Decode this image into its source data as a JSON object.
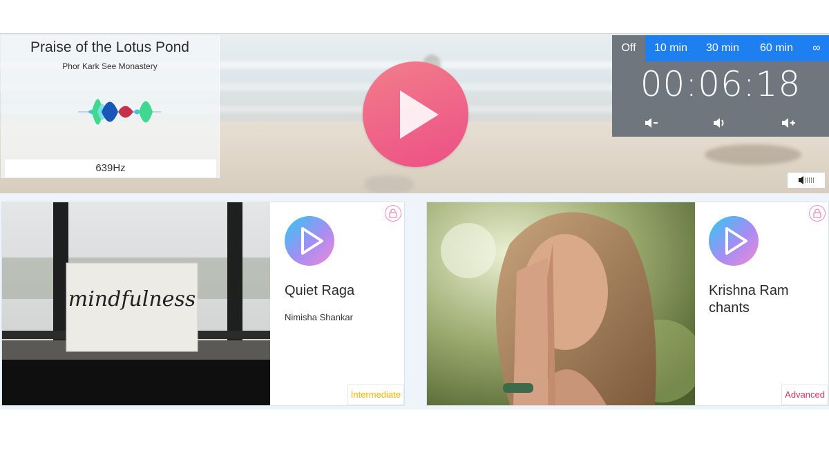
{
  "player": {
    "track_title": "Praise of the Lotus Pond",
    "track_artist": "Phor Kark See Monastery",
    "frequency": "639Hz",
    "play_icon": "play-icon"
  },
  "timer": {
    "tabs": [
      {
        "label": "Off",
        "active": true
      },
      {
        "label": "10 min",
        "active": false
      },
      {
        "label": "30 min",
        "active": false
      },
      {
        "label": "60 min",
        "active": false
      },
      {
        "label": "∞",
        "active": false
      }
    ],
    "time": "00:06:18",
    "controls": [
      "volume-down-icon",
      "volume-icon",
      "volume-up-icon"
    ],
    "mute_icon": "mute-volume-icon"
  },
  "cards": [
    {
      "title": "Quiet Raga",
      "subtitle": "Nimisha Shankar",
      "level": "Intermediate",
      "level_color": "#f5b400",
      "photo_text": "mindfulness"
    },
    {
      "title": "Krishna Ram chants",
      "subtitle": "",
      "level": "Advanced",
      "level_color": "#e0345a"
    }
  ],
  "colors": {
    "accent": "#1e7ff0",
    "play_pink": "#ec4f86",
    "timer_bg": "#6f767e"
  }
}
